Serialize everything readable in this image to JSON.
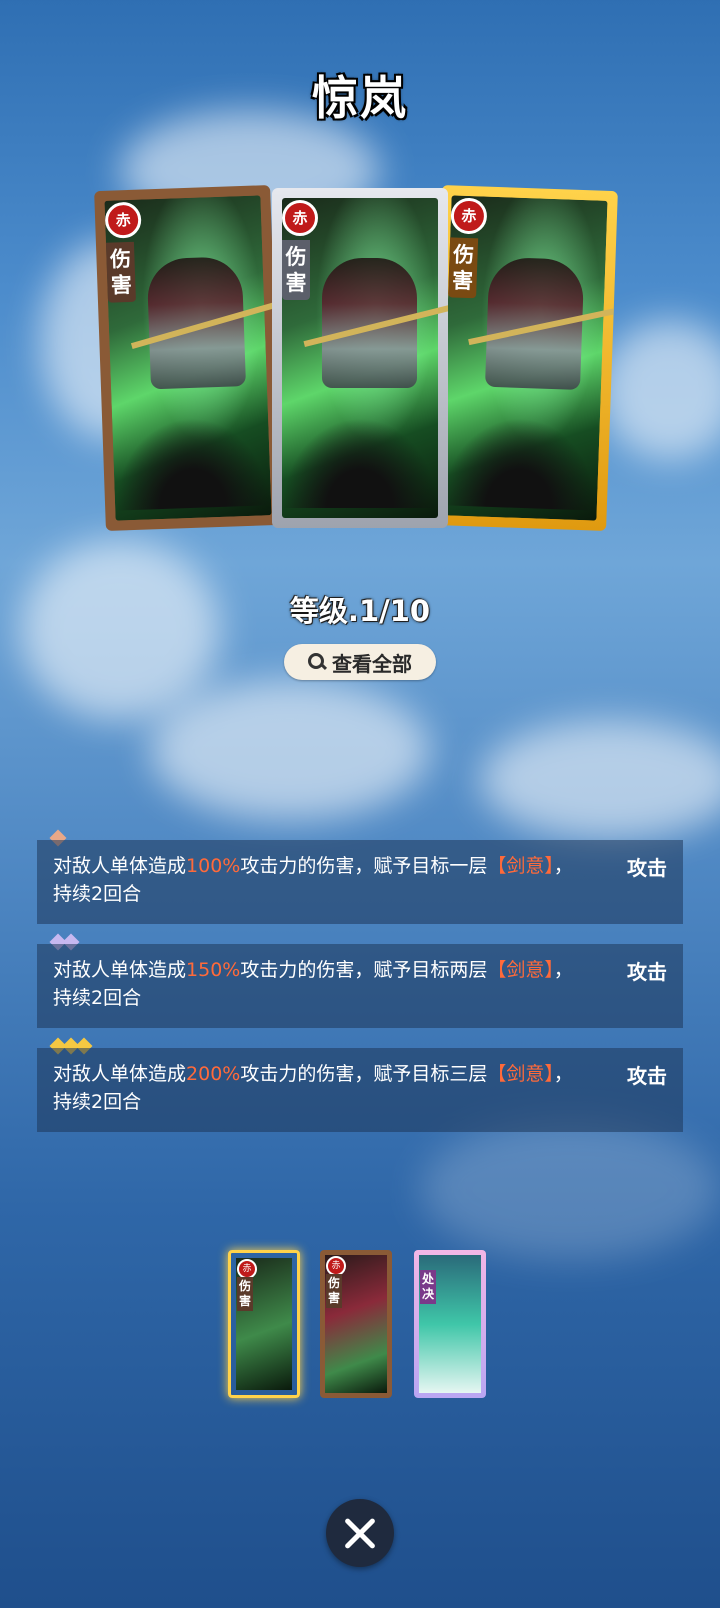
{
  "page_title": "惊岚",
  "cards": [
    {
      "element": "赤",
      "tag": "伤害",
      "frame": "bronze"
    },
    {
      "element": "赤",
      "tag": "伤害",
      "frame": "silver"
    },
    {
      "element": "赤",
      "tag": "伤害",
      "frame": "gold"
    }
  ],
  "level_label": "等级.1/10",
  "view_all_label": "查看全部",
  "skills": [
    {
      "stars": 1,
      "star_color": "#e8a888",
      "desc_prefix": "对敌人单体造成",
      "percent": "100%",
      "desc_mid": "攻击力的伤害，赋予目标一层",
      "keyword": "【剑意】",
      "desc_suffix": "，持续2回合",
      "type": "攻击"
    },
    {
      "stars": 2,
      "star_color": "#c7b8f0",
      "desc_prefix": "对敌人单体造成",
      "percent": "150%",
      "desc_mid": "攻击力的伤害，赋予目标两层",
      "keyword": "【剑意】",
      "desc_suffix": "，持续2回合",
      "type": "攻击"
    },
    {
      "stars": 3,
      "star_color": "#f5c842",
      "desc_prefix": "对敌人单体造成",
      "percent": "200%",
      "desc_mid": "攻击力的伤害，赋予目标三层",
      "keyword": "【剑意】",
      "desc_suffix": "，持续2回合",
      "type": "攻击"
    }
  ],
  "deck": [
    {
      "element": "赤",
      "tag": "伤害",
      "selected": true
    },
    {
      "element": "赤",
      "tag": "伤害",
      "selected": false
    },
    {
      "element": "",
      "tag": "处决",
      "selected": false
    }
  ],
  "colors": {
    "highlight": "#ff6a3a",
    "bronze": "#8a5a36",
    "silver": "#b8bcc6",
    "gold": "#f2b528"
  }
}
